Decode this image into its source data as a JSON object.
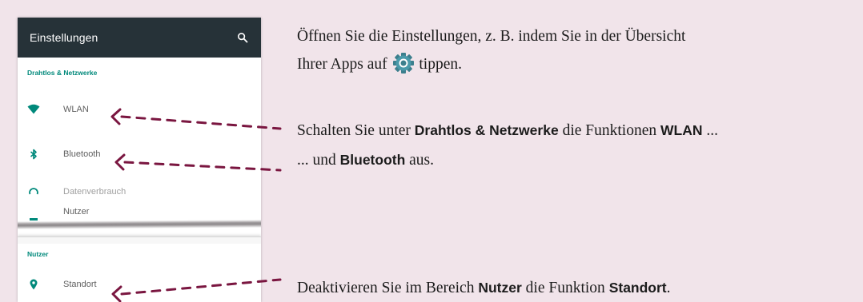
{
  "phone": {
    "appbar": {
      "title": "Einstellungen",
      "search_icon": "search-icon"
    },
    "sections": {
      "wireless": "Drahtlos & Netzwerke",
      "user": "Nutzer"
    },
    "rows": {
      "wlan": {
        "label": "WLAN",
        "icon": "wifi-icon"
      },
      "bluetooth": {
        "label": "Bluetooth",
        "icon": "bluetooth-icon"
      },
      "data_usage": {
        "label": "Datenverbrauch",
        "icon": "data-usage-icon"
      },
      "users": {
        "label": "Nutzer",
        "icon": "person-icon"
      },
      "location": {
        "label": "Standort",
        "icon": "location-pin-icon"
      }
    }
  },
  "instructions": {
    "step1": {
      "before": "Öffnen Sie die Einstellungen, z. B. indem Sie in der Übersicht",
      "line2_before": "Ihrer Apps auf ",
      "line2_after": " tippen.",
      "icon": "settings-gear-icon"
    },
    "step2": {
      "t1": "Schalten Sie unter ",
      "b1": "Drahtlos & Netzwerke",
      "t2": " die Funktionen ",
      "b2": "WLAN",
      "t3": " ..."
    },
    "step3": {
      "t1": "... und ",
      "b1": "Bluetooth",
      "t2": " aus."
    },
    "step4": {
      "t1": "Deaktivieren Sie im Bereich ",
      "b1": "Nutzer",
      "t2": " die Funktion ",
      "b2": "Standort",
      "t3": "."
    }
  },
  "colors": {
    "background": "#f1e4ea",
    "appbar": "#263238",
    "accent_teal": "#00897b",
    "arrow": "#7a1640"
  }
}
